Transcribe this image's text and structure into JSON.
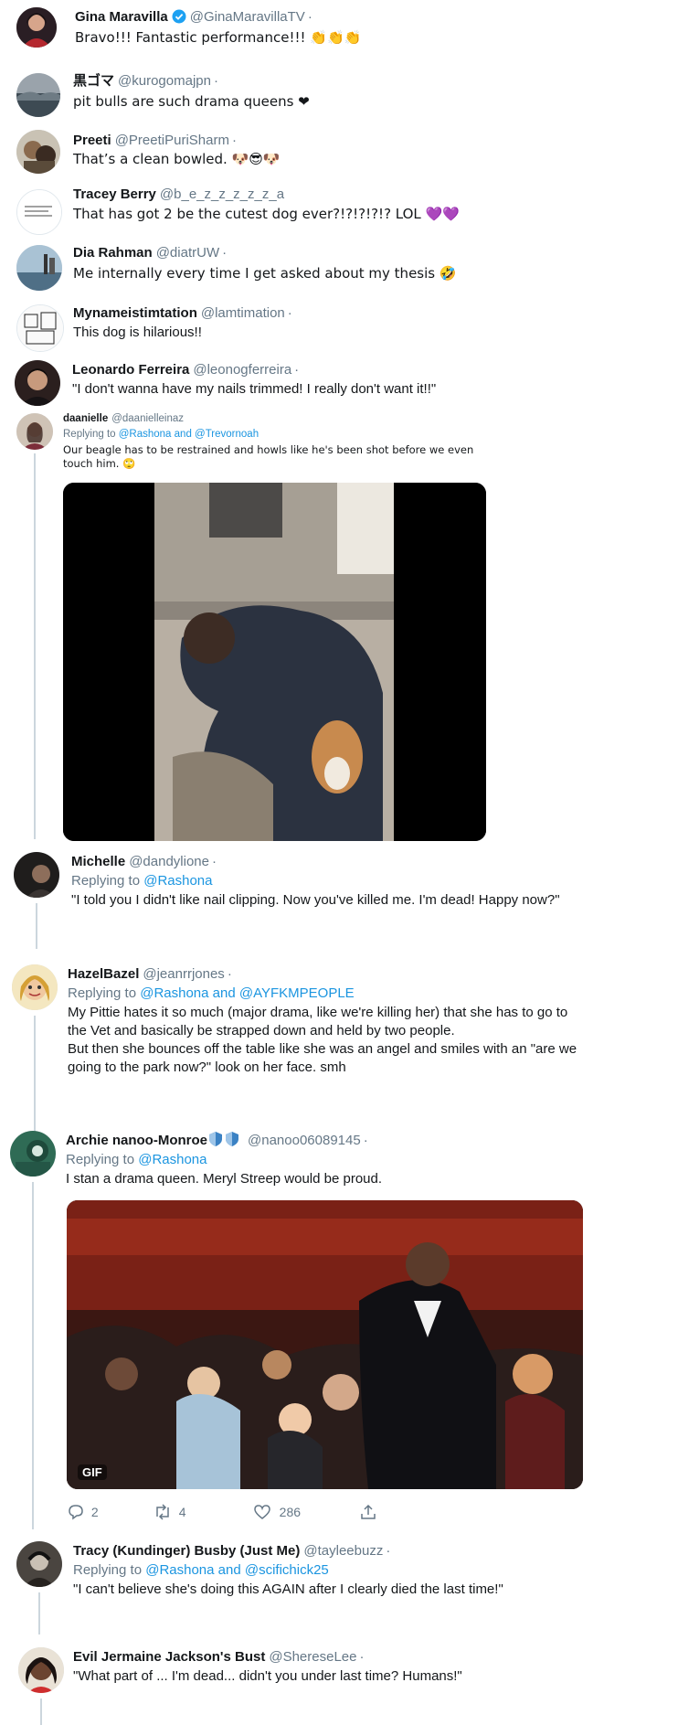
{
  "tweets": [
    {
      "name": "Gina Maravilla",
      "handle": "@GinaMaravillaTV",
      "sep": "·",
      "text": "Bravo!!! Fantastic performance!!! 👏👏👏"
    },
    {
      "name": "黒ゴマ",
      "handle": "@kurogomajpn",
      "sep": "·",
      "text": "pit bulls are such drama queens ❤"
    },
    {
      "name": "Preeti",
      "handle": "@PreetiPuriSharm",
      "sep": "·",
      "text": "That’s a clean bowled. 🐶😎🐶"
    },
    {
      "name": "Tracey Berry",
      "handle": "@b_e_z_z_z_z_z_a",
      "sep": "·",
      "text": "That has got 2 be the cutest dog ever?!?!?!?!? LOL 💜💜"
    },
    {
      "name": "Dia Rahman",
      "handle": "@diatrUW",
      "sep": "·",
      "text": "Me internally every time I get asked about my thesis 🤣"
    },
    {
      "name": "Mynameistimtation",
      "handle": "@lamtimation",
      "sep": "·",
      "text": "This dog is hilarious!!"
    },
    {
      "name": "Leonardo Ferreira",
      "handle": "@leonogferreira",
      "sep": "·",
      "text": "\"I don't wanna have my nails trimmed! I really don't want it!!\""
    },
    {
      "name": "daanielle",
      "handle": "@daanielleinaz",
      "sep": "·",
      "reply_prefix": "Replying to",
      "reply_to": "@Rashona and @Trevornoah",
      "text": "Our beagle has to be restrained and howls like he's been shot before we even\ntouch him. 🙄"
    },
    {
      "name": "Michelle",
      "handle": "@dandylione",
      "sep": "·",
      "reply_prefix": "Replying to",
      "reply_to": "@Rashona",
      "text": "\"I told you I didn't like nail clipping. Now you've killed me. I'm dead! Happy now?\""
    },
    {
      "name": "HazelBazel",
      "handle": "@jeanrrjones",
      "sep": "·",
      "reply_prefix": "Replying to",
      "reply_to": "@Rashona and @AYFKMPEOPLE",
      "text": "My Pittie hates it so much (major drama, like we're killing her) that she has to go to\nthe Vet and basically be strapped down and held by two people.\nBut then she bounces off the table like she was an angel and smiles with an \"are we\ngoing to the park now?\" look on her face. smh"
    },
    {
      "name": "Archie nanoo-Monroe",
      "handle": "@nanoo06089145",
      "sep": "·",
      "reply_prefix": "Replying to",
      "reply_to": "@Rashona",
      "text": "I stan a drama queen. Meryl Streep would be proud.",
      "gif_label": "GIF",
      "replies": "2",
      "retweets": "4",
      "likes": "286"
    },
    {
      "name": "Tracy (Kundinger) Busby (Just Me)",
      "handle": "@tayleebuzz",
      "sep": "·",
      "reply_prefix": "Replying to",
      "reply_to": "@Rashona and @scifichick25",
      "text": "\"I can't believe she's doing this AGAIN after I clearly died the last time!\""
    },
    {
      "name": "Evil Jermaine Jackson's Bust",
      "handle": "@ShereseLee",
      "sep": "·",
      "text": "\"What part of ... I'm dead... didn't you under last time? Humans!\""
    }
  ],
  "colors": {
    "link": "#1b95e0",
    "muted": "#657786",
    "verified": "#1da1f2",
    "thread": "#ccd6dd"
  }
}
